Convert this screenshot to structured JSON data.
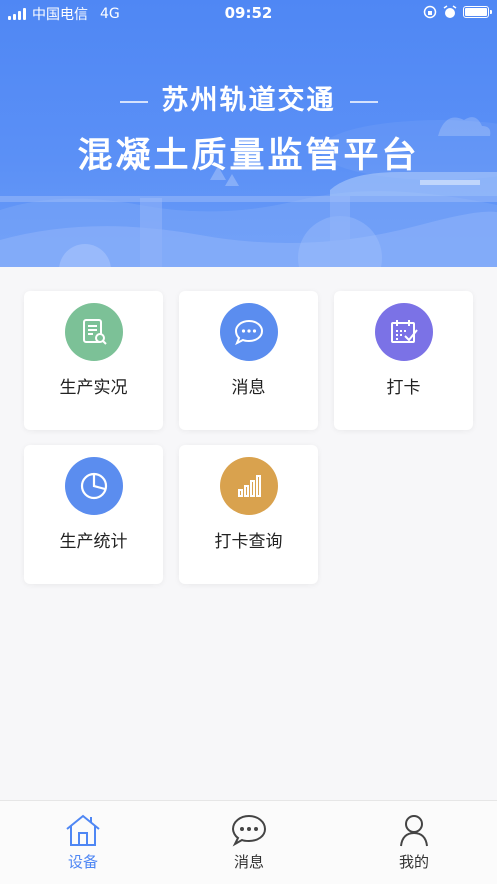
{
  "statusbar": {
    "carrier": "中国电信",
    "network": "4G",
    "time": "09:52"
  },
  "hero": {
    "subtitle": "苏州轨道交通",
    "title": "混凝土质量监管平台"
  },
  "colors": {
    "hero_blue": "#4f87f4",
    "green": "#7cc197",
    "blue": "#5b8def",
    "purple": "#7b72e6",
    "orange": "#d9a24e",
    "active_tab": "#4f87f4"
  },
  "menu": [
    {
      "label": "生产实况",
      "icon": "document-search-icon"
    },
    {
      "label": "消息",
      "icon": "chat-bubble-icon"
    },
    {
      "label": "打卡",
      "icon": "calendar-check-icon"
    },
    {
      "label": "生产统计",
      "icon": "pie-chart-icon"
    },
    {
      "label": "打卡查询",
      "icon": "bar-chart-icon"
    }
  ],
  "tabs": [
    {
      "label": "设备",
      "icon": "home-icon",
      "active": true
    },
    {
      "label": "消息",
      "icon": "chat-bubble-icon",
      "active": false
    },
    {
      "label": "我的",
      "icon": "user-icon",
      "active": false
    }
  ]
}
